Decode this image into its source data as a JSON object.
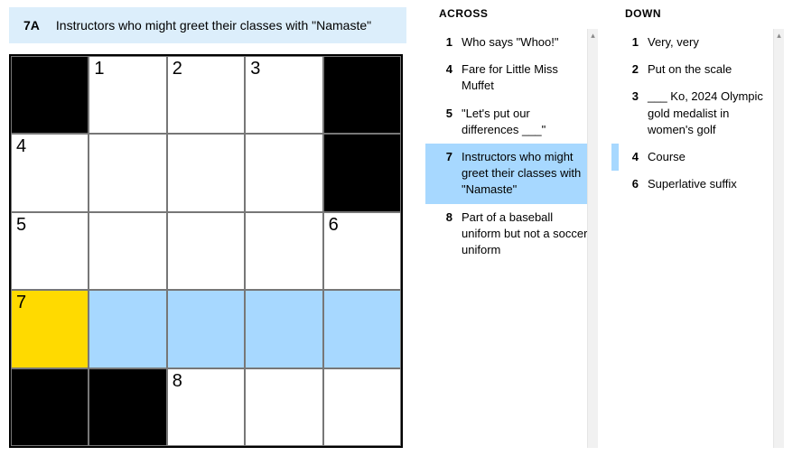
{
  "currentClue": {
    "id": "7A",
    "text": "Instructors who might greet their classes with \"Namaste\""
  },
  "grid": {
    "size": 5,
    "cells": [
      [
        {
          "black": true
        },
        {
          "num": "1"
        },
        {
          "num": "2"
        },
        {
          "num": "3"
        },
        {
          "black": true
        }
      ],
      [
        {
          "num": "4"
        },
        {},
        {},
        {},
        {
          "black": true
        }
      ],
      [
        {
          "num": "5"
        },
        {},
        {},
        {},
        {
          "num": "6"
        }
      ],
      [
        {
          "num": "7",
          "active": true
        },
        {
          "hl": true
        },
        {
          "hl": true
        },
        {
          "hl": true
        },
        {
          "hl": true
        }
      ],
      [
        {
          "black": true
        },
        {
          "black": true
        },
        {
          "num": "8"
        },
        {},
        {}
      ]
    ]
  },
  "across": {
    "heading": "ACROSS",
    "clues": [
      {
        "num": "1",
        "text": "Who says \"Whoo!\""
      },
      {
        "num": "4",
        "text": "Fare for Little Miss Muffet"
      },
      {
        "num": "5",
        "text": "\"Let's put our differences ___\""
      },
      {
        "num": "7",
        "text": "Instructors who might greet their classes with \"Namaste\"",
        "selected": true
      },
      {
        "num": "8",
        "text": "Part of a baseball uniform but not a soccer uniform"
      }
    ]
  },
  "down": {
    "heading": "DOWN",
    "clues": [
      {
        "num": "1",
        "text": "Very, very"
      },
      {
        "num": "2",
        "text": "Put on the scale"
      },
      {
        "num": "3",
        "text": "___ Ko, 2024 Olympic gold medalist in women's golf"
      },
      {
        "num": "4",
        "text": "Course",
        "related": true
      },
      {
        "num": "6",
        "text": "Superlative suffix"
      }
    ]
  }
}
